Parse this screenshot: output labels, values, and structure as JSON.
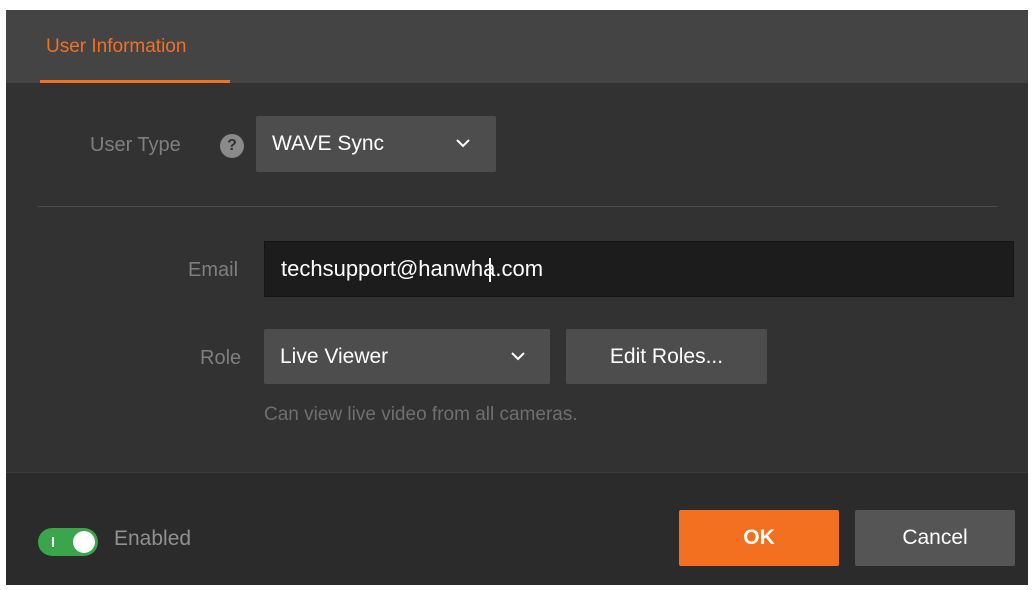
{
  "tabs": [
    {
      "label": "User Information",
      "active": true
    }
  ],
  "user_type": {
    "label": "User Type",
    "help_icon": "question-circle-icon",
    "value": "WAVE Sync"
  },
  "email": {
    "label": "Email",
    "value": "techsupport@hanwha.com"
  },
  "role": {
    "label": "Role",
    "value": "Live Viewer",
    "edit_button": "Edit Roles...",
    "description": "Can view live video from all cameras."
  },
  "footer": {
    "enabled_label": "Enabled",
    "enabled": true,
    "ok_label": "OK",
    "cancel_label": "Cancel"
  },
  "colors": {
    "accent": "#f37021",
    "toggle_on": "#3aa54a",
    "background": "#323232"
  }
}
